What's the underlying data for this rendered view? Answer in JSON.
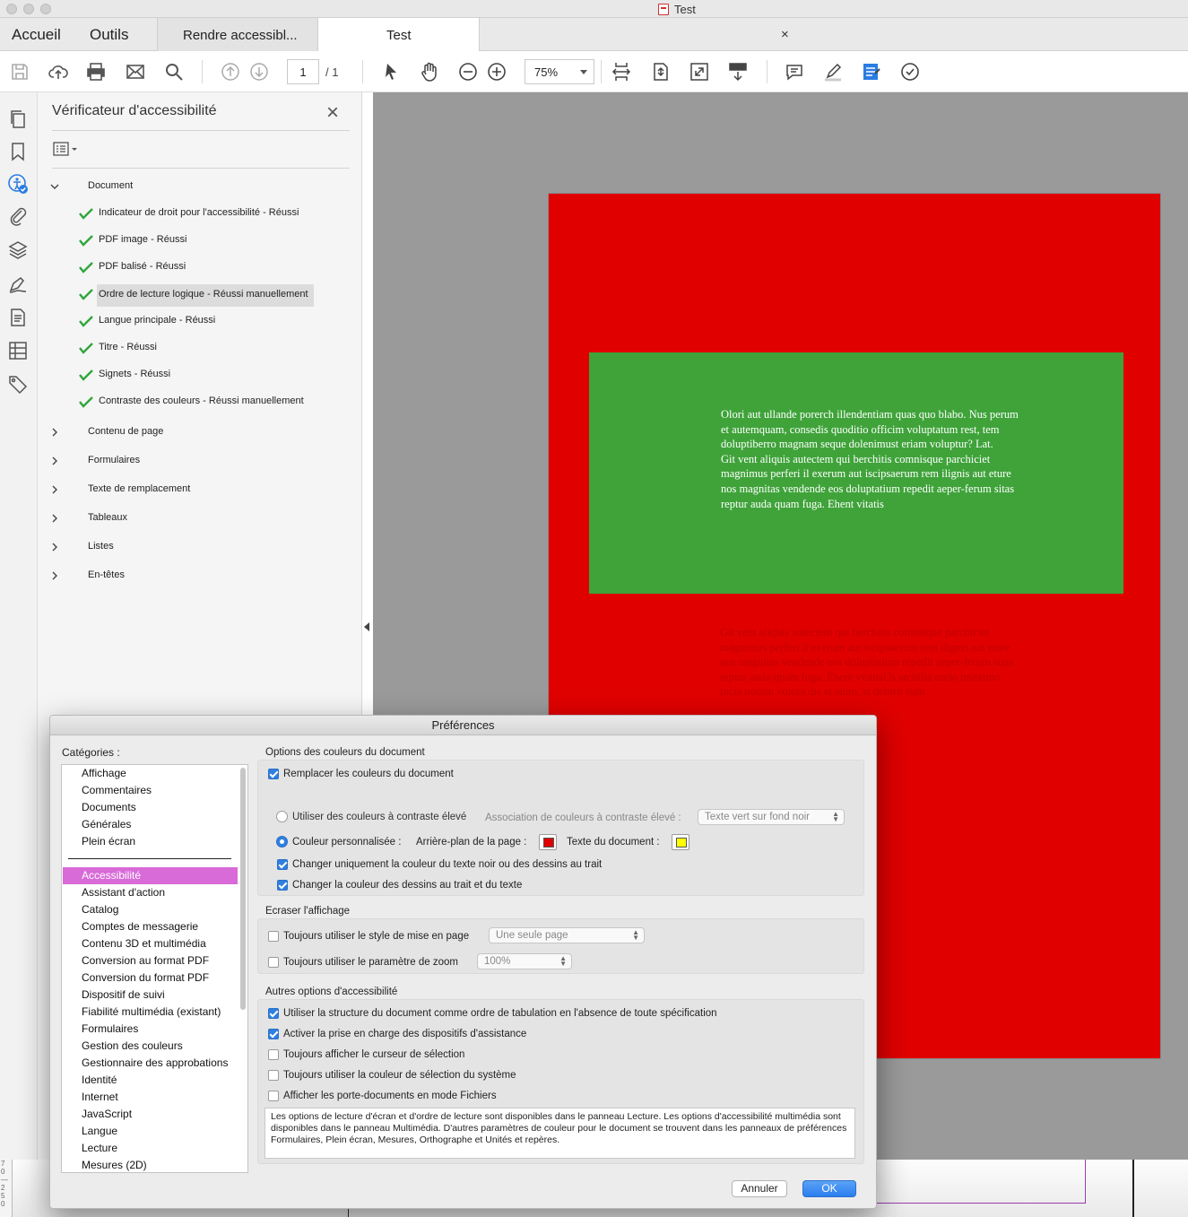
{
  "window": {
    "title": "Test"
  },
  "tabs": {
    "home": "Accueil",
    "tools": "Outils",
    "doc_tabs": [
      {
        "label": "Rendre accessibl..."
      },
      {
        "label": "Test",
        "close": "×"
      }
    ]
  },
  "toolbar": {
    "page_current": "1",
    "page_total": "/ 1",
    "zoom": "75%"
  },
  "panel": {
    "title": "Vérificateur d'accessibilité",
    "close": "×",
    "tree": [
      {
        "label": "Document",
        "expanded": true,
        "children": [
          {
            "label": "Indicateur de droit pour l'accessibilité - Réussi"
          },
          {
            "label": "PDF image - Réussi"
          },
          {
            "label": "PDF balisé - Réussi"
          },
          {
            "label": "Ordre de lecture logique - Réussi manuellement",
            "selected": true
          },
          {
            "label": "Langue principale - Réussi"
          },
          {
            "label": "Titre - Réussi"
          },
          {
            "label": "Signets - Réussi"
          },
          {
            "label": "Contraste des couleurs - Réussi manuellement"
          }
        ]
      },
      {
        "label": "Contenu de page"
      },
      {
        "label": "Formulaires"
      },
      {
        "label": "Texte de remplacement"
      },
      {
        "label": "Tableaux"
      },
      {
        "label": "Listes"
      },
      {
        "label": "En-têtes"
      }
    ]
  },
  "document": {
    "page_color": "#e00000",
    "box_color": "#3fa33a",
    "green_text": "Olori aut ullande porerch illendentiam quas quo blabo. Nus perum et autemquam, consedis quoditio officim voluptatum rest, tem doluptiberro magnam seque dolenimust eriam voluptur? Lat.\nGit vent aliquis autectem qui berchitis comnisque parchiciet magnimus perferi il exerum aut iscipsaerum rem ilignis aut eture nos magnitas vendende eos doluptatium repedit aeper-ferum sitas reptur auda quam fuga. Ehent vitatis",
    "red_text": "Git vent aliquis autectem qui berchitis comnisque parchiciet magnimus perferi il exerum aut iscipsaerum rem ilignis aut eture nos magnitas vendende eos doluptatium repedit aeper-ferum sitas reptur auda quam fuga. Ehent vitatisUs archilia corio imaximo incia nosam volora dis et eium, si dolorit eum"
  },
  "ruler": "7\n0\n—\n2\n5\n0",
  "preferences": {
    "title": "Préférences",
    "categories_label": "Catégories :",
    "categories_top": [
      "Affichage",
      "Commentaires",
      "Documents",
      "Générales",
      "Plein écran"
    ],
    "categories_bottom": [
      "Accessibilité",
      "Assistant d'action",
      "Catalog",
      "Comptes de messagerie",
      "Contenu 3D et multimédia",
      "Conversion au format PDF",
      "Conversion du format PDF",
      "Dispositif de suivi",
      "Fiabilité multimédia (existant)",
      "Formulaires",
      "Gestion des couleurs",
      "Gestionnaire des approbations",
      "Identité",
      "Internet",
      "JavaScript",
      "Langue",
      "Lecture",
      "Mesures (2D)"
    ],
    "active_category": "Accessibilité",
    "accent": "#d86bd8",
    "colors_group": {
      "label": "Options des couleurs du document",
      "replace": {
        "label": "Remplacer les couleurs du document",
        "checked": true
      },
      "high_contrast": {
        "label": "Utiliser des couleurs à contraste élevé",
        "selected": false
      },
      "assoc_label": "Association de couleurs à contraste élevé :",
      "assoc_value": "Texte vert sur fond noir",
      "custom": {
        "label": "Couleur personnalisée :",
        "selected": true
      },
      "background_label": "Arrière-plan de la page :",
      "background_color": "#e00000",
      "text_label": "Texte du document :",
      "text_color": "#ffff00",
      "only_black": {
        "label": "Changer uniquement la couleur du texte noir ou des dessins au trait",
        "checked": true
      },
      "line_art": {
        "label": "Changer la couleur des dessins au trait et du texte",
        "checked": true
      }
    },
    "override_group": {
      "label": "Ecraser l'affichage",
      "layout": {
        "label": "Toujours utiliser le style de mise en page",
        "checked": false,
        "value": "Une seule page"
      },
      "zoom": {
        "label": "Toujours utiliser le paramètre de zoom",
        "checked": false,
        "value": "100%"
      }
    },
    "other_group": {
      "label": "Autres options d'accessibilité",
      "items": [
        {
          "label": "Utiliser la structure du document comme ordre de tabulation en l'absence de toute spécification",
          "checked": true
        },
        {
          "label": "Activer la prise en charge des dispositifs d'assistance",
          "checked": true
        },
        {
          "label": "Toujours afficher le curseur de sélection",
          "checked": false
        },
        {
          "label": "Toujours utiliser la couleur de sélection du système",
          "checked": false
        },
        {
          "label": "Afficher les porte-documents en mode Fichiers",
          "checked": false
        }
      ]
    },
    "note": "Les options de lecture d'écran et d'ordre de lecture sont disponibles dans le panneau Lecture. Les options d'accessibilité multimédia sont disponibles dans le panneau Multimédia. D'autres paramètres de couleur pour le document se trouvent dans les panneaux de préférences Formulaires, Plein écran, Mesures, Orthographe et Unités et repères.",
    "cancel": "Annuler",
    "ok": "OK"
  },
  "icons": {
    "toolbar": [
      "save-icon",
      "upload-cloud-icon",
      "print-icon",
      "email-icon",
      "search-icon",
      "page-up-icon",
      "page-down-icon",
      "select-arrow-icon",
      "hand-icon",
      "zoom-out-icon",
      "zoom-in-icon",
      "fit-width-icon",
      "fit-page-icon",
      "fullscreen-icon",
      "scroll-mode-icon",
      "comment-icon",
      "highlight-icon",
      "fill-sign-icon",
      "check-circle-icon"
    ],
    "rail": [
      "pages-icon",
      "bookmark-icon",
      "accessibility-icon",
      "attachment-icon",
      "layers-icon",
      "signature-icon",
      "content-icon",
      "order-icon",
      "tags-icon"
    ]
  }
}
